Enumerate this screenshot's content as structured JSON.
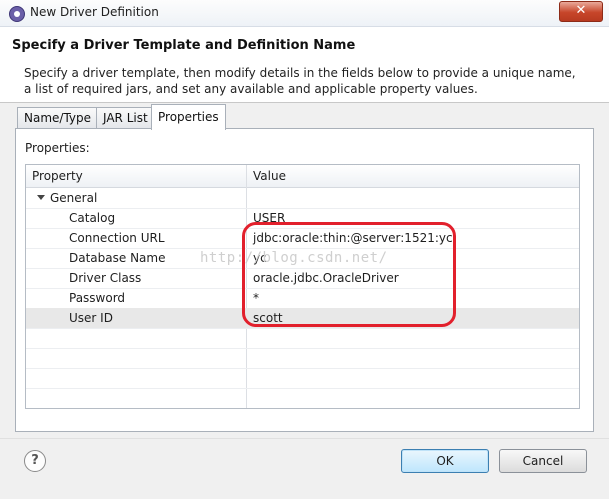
{
  "window": {
    "title": "New Driver Definition",
    "close_glyph": "✕"
  },
  "header": {
    "title": "Specify a Driver Template and Definition Name",
    "description": "Specify a driver template, then modify details in the fields below to provide a unique name, a list of required jars, and set any available and applicable property values."
  },
  "tabs": [
    {
      "label": "Name/Type",
      "active": false
    },
    {
      "label": "JAR List",
      "active": false
    },
    {
      "label": "Properties",
      "active": true
    }
  ],
  "properties": {
    "label": "Properties:",
    "columns": [
      "Property",
      "Value"
    ],
    "group": "General",
    "rows": [
      {
        "property": "Catalog",
        "value": "USER"
      },
      {
        "property": "Connection URL",
        "value": "jdbc:oracle:thin:@server:1521:yc"
      },
      {
        "property": "Database Name",
        "value": "yc"
      },
      {
        "property": "Driver Class",
        "value": "oracle.jdbc.OracleDriver"
      },
      {
        "property": "Password",
        "value": "*"
      },
      {
        "property": "User ID",
        "value": "scott",
        "selected": true
      }
    ]
  },
  "watermark": "http://blog.csdn.net/",
  "footer": {
    "help_glyph": "?",
    "ok_label": "OK",
    "cancel_label": "Cancel"
  },
  "colors": {
    "highlight": "#e2202c",
    "close_button": "#c7462a"
  }
}
